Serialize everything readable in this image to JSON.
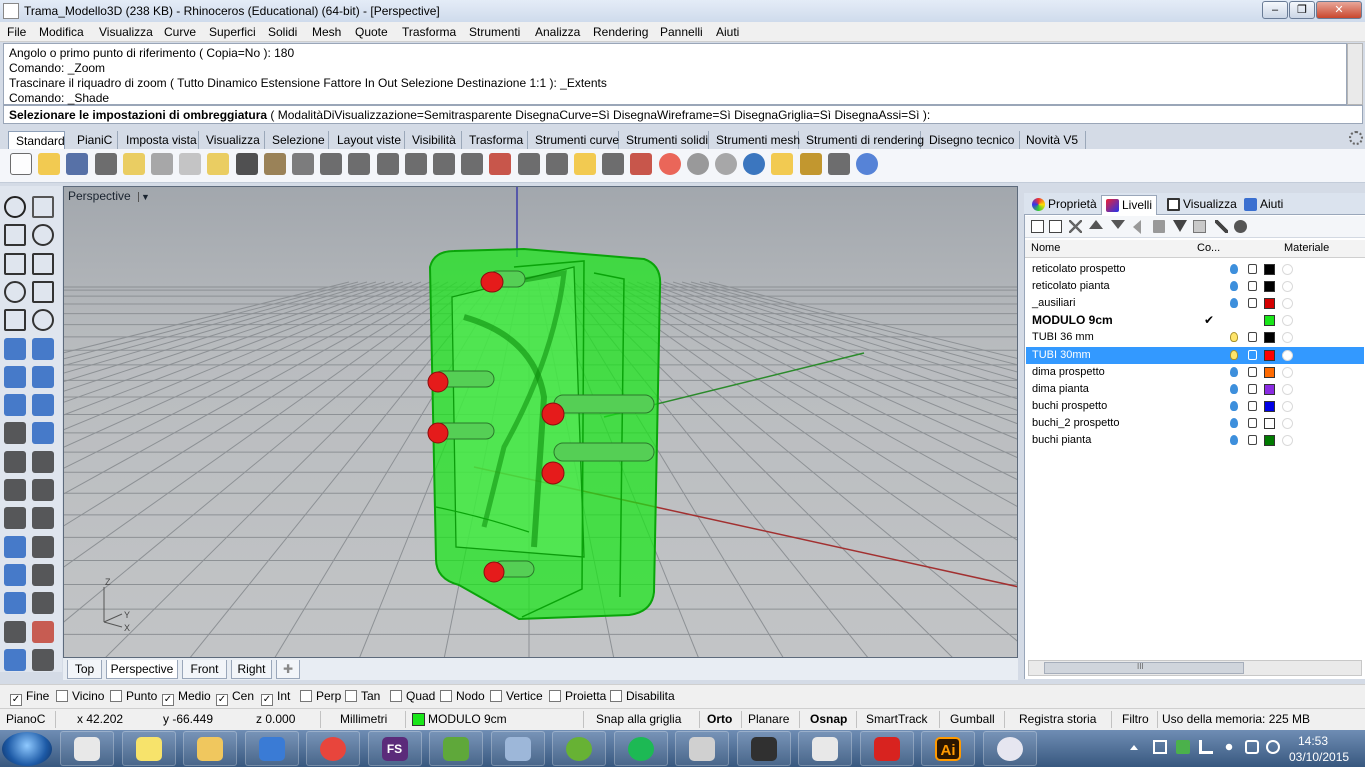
{
  "window": {
    "title": "Trama_Modello3D (238 KB) - Rhinoceros (Educational) (64-bit) - [Perspective]",
    "min_glyph": "–",
    "max_glyph": "❐",
    "close_glyph": "✕"
  },
  "menu": [
    "File",
    "Modifica",
    "Visualizza",
    "Curve",
    "Superfici",
    "Solidi",
    "Mesh",
    "Quote",
    "Trasforma",
    "Strumenti",
    "Analizza",
    "Rendering",
    "Pannelli",
    "Aiuti"
  ],
  "command_history": [
    "Angolo o primo punto di riferimento ( Copia=No ): 180",
    "Comando: _Zoom",
    "Trascinare il riquadro di zoom ( Tutto  Dinamico  Estensione  Fattore  In  Out  Selezione  Destinazione  1:1 ): _Extents",
    "Comando: _Shade"
  ],
  "command_prompt": {
    "label": "Selezionare le impostazioni di ombreggiatura",
    "options": "( ModalitàDiVisualizzazione=Semitrasparente  DisegnaCurve=Sì  DisegnaWireframe=Sì  DisegnaGriglia=Sì  DisegnaAssi=Sì ):"
  },
  "toolbar_tabs": [
    "Standard",
    "PianiC",
    "Imposta vista",
    "Visualizza",
    "Selezione",
    "Layout viste",
    "Visibilità",
    "Trasforma",
    "Strumenti curve",
    "Strumenti solidi",
    "Strumenti mesh",
    "Strumenti di rendering",
    "Disegno tecnico",
    "Novità V5"
  ],
  "toolbar_icons": [
    "new-file-icon",
    "open-file-icon",
    "save-icon",
    "print-icon",
    "import-icon",
    "cut-icon",
    "copy-icon",
    "paste-icon",
    "undo-icon",
    "pan-icon",
    "rotate-view-icon",
    "zoom-dynamic-icon",
    "zoom-window-icon",
    "zoom-extents-icon",
    "zoom-selected-icon",
    "undo-view-icon",
    "four-viewports-icon",
    "car-icon",
    "grid-icon",
    "cplane-icon",
    "light-bulb-icon",
    "lock-icon",
    "layer-icon",
    "color-wheel-icon",
    "display-sphere-icon",
    "render-sphere-icon",
    "render-blue-sphere-icon",
    "sun-icon",
    "gear-icon",
    "cursor-icon",
    "help-icon"
  ],
  "left_tools": [
    "select-icon",
    "point-icon",
    "polyline-icon",
    "curve-icon",
    "circle-icon",
    "ellipse-icon",
    "arc-icon",
    "rectangle-icon",
    "polygon-icon",
    "fillet-curve-icon",
    "surface-icon",
    "extrude-icon",
    "box-icon",
    "sphere-icon",
    "cylinder-icon",
    "mesh-icon",
    "boolean-icon",
    "solid-tools-icon",
    "trim-icon",
    "split-icon",
    "boolean-union-icon",
    "boolean-split-icon",
    "offset-icon",
    "blend-icon",
    "text-icon",
    "dimension-icon",
    "array-icon",
    "scale-icon",
    "plane-icon",
    "grid-snap-icon",
    "array-grid-icon",
    "gumball-icon",
    "solid-edit-icon",
    "more-tools-icon"
  ],
  "viewport": {
    "label": "Perspective",
    "dropdown_glyph": "▼",
    "axis_labels": {
      "z": "Z",
      "y": "Y",
      "x": "X"
    }
  },
  "viewport_tabs": [
    "Top",
    "Perspective",
    "Front",
    "Right"
  ],
  "viewport_tab_add": "✚",
  "panel": {
    "tabs": [
      "Proprietà",
      "Livelli",
      "Visualizza",
      "Aiuti"
    ],
    "columns": {
      "name": "Nome",
      "current": "Co...",
      "material": "Materiale"
    },
    "layers": [
      {
        "name": "reticolato prospetto",
        "color": "#000000",
        "bulb": "off",
        "current": false,
        "selected": false,
        "bold": false
      },
      {
        "name": "reticolato pianta",
        "color": "#000000",
        "bulb": "off",
        "current": false,
        "selected": false,
        "bold": false
      },
      {
        "name": "_ausiliari",
        "color": "#d40000",
        "bulb": "off",
        "current": false,
        "selected": false,
        "bold": false
      },
      {
        "name": "MODULO 9cm",
        "color": "#19e619",
        "bulb": "none",
        "current": true,
        "selected": false,
        "bold": true
      },
      {
        "name": "TUBI 36 mm",
        "color": "#000000",
        "bulb": "on",
        "current": false,
        "selected": false,
        "bold": false
      },
      {
        "name": "TUBI 30mm",
        "color": "#ff0000",
        "bulb": "on",
        "current": false,
        "selected": true,
        "bold": false
      },
      {
        "name": "dima prospetto",
        "color": "#ff6a00",
        "bulb": "off",
        "current": false,
        "selected": false,
        "bold": false
      },
      {
        "name": "dima pianta",
        "color": "#8a2be2",
        "bulb": "off",
        "current": false,
        "selected": false,
        "bold": false
      },
      {
        "name": "buchi prospetto",
        "color": "#0000e6",
        "bulb": "off",
        "current": false,
        "selected": false,
        "bold": false
      },
      {
        "name": "buchi_2 prospetto",
        "color": "#ffffff",
        "bulb": "off",
        "current": false,
        "selected": false,
        "bold": false
      },
      {
        "name": "buchi pianta",
        "color": "#007a00",
        "bulb": "off",
        "current": false,
        "selected": false,
        "bold": false
      }
    ],
    "current_mark": "✔",
    "scroll_grip": "III"
  },
  "osnap": [
    {
      "label": "Fine",
      "checked": true
    },
    {
      "label": "Vicino",
      "checked": false
    },
    {
      "label": "Punto",
      "checked": false
    },
    {
      "label": "Medio",
      "checked": true
    },
    {
      "label": "Cen",
      "checked": true
    },
    {
      "label": "Int",
      "checked": true
    },
    {
      "label": "Perp",
      "checked": false
    },
    {
      "label": "Tan",
      "checked": false
    },
    {
      "label": "Quad",
      "checked": false
    },
    {
      "label": "Nodo",
      "checked": false
    },
    {
      "label": "Vertice",
      "checked": false
    },
    {
      "label": "Proietta",
      "checked": false
    },
    {
      "label": "Disabilita",
      "checked": false
    }
  ],
  "status": {
    "cplane": "PianoC",
    "x": "x 42.202",
    "y": "y -66.449",
    "z": "z 0.000",
    "units": "Millimetri",
    "layer": "MODULO 9cm",
    "layer_color": "#19e619",
    "toggles": [
      {
        "label": "Snap alla griglia",
        "bold": false
      },
      {
        "label": "Orto",
        "bold": true
      },
      {
        "label": "Planare",
        "bold": false
      },
      {
        "label": "Osnap",
        "bold": true
      },
      {
        "label": "SmartTrack",
        "bold": false
      },
      {
        "label": "Gumball",
        "bold": false
      },
      {
        "label": "Registra storia",
        "bold": false
      },
      {
        "label": "Filtro",
        "bold": false
      }
    ],
    "memory": "Uso della memoria: 225 MB"
  },
  "taskbar": {
    "apps": [
      "snipping-tool-icon",
      "sticky-notes-icon",
      "file-explorer-icon",
      "thunderbird-icon",
      "chrome-icon",
      "fs-app-icon",
      "evernote-icon",
      "scanner-icon",
      "utorrent-icon",
      "spotify-icon",
      "calculator-icon",
      "rhino-icon",
      "notepad-icon",
      "acrobat-icon",
      "illustrator-icon",
      "itunes-icon"
    ],
    "fs_label": "FS",
    "ai_label": "Ai",
    "time": "14:53",
    "date": "03/10/2015"
  }
}
